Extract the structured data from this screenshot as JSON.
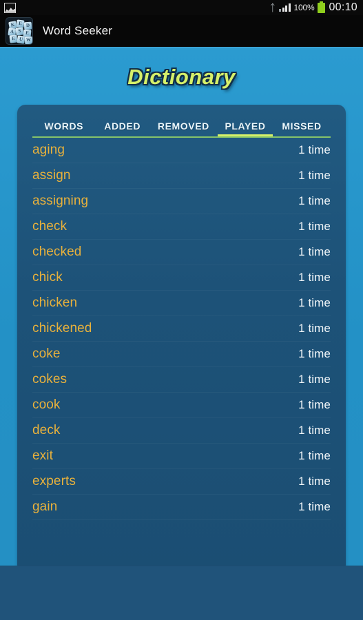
{
  "status_bar": {
    "notification_icon": "image-screenshot-icon",
    "bluetooth_icon": "bluetooth-icon",
    "signal_icon": "signal-bars-icon",
    "battery_percent": "100%",
    "battery_icon": "battery-full-icon",
    "clock": "00:10"
  },
  "action_bar": {
    "app_icon": "word-seeker-app-icon",
    "app_title": "Word Seeker",
    "icon_tiles": [
      "K",
      "E",
      "D",
      "A",
      "S",
      "E",
      "E",
      "U",
      "W"
    ]
  },
  "screen": {
    "title": "Dictionary"
  },
  "tabs": [
    {
      "label": "WORDS",
      "selected": false
    },
    {
      "label": "ADDED",
      "selected": false
    },
    {
      "label": "REMOVED",
      "selected": false
    },
    {
      "label": "PLAYED",
      "selected": true
    },
    {
      "label": "MISSED",
      "selected": false
    }
  ],
  "word_list": [
    {
      "word": "aging",
      "count": "1 time"
    },
    {
      "word": "assign",
      "count": "1 time"
    },
    {
      "word": "assigning",
      "count": "1 time"
    },
    {
      "word": "check",
      "count": "1 time"
    },
    {
      "word": "checked",
      "count": "1 time"
    },
    {
      "word": "chick",
      "count": "1 time"
    },
    {
      "word": "chicken",
      "count": "1 time"
    },
    {
      "word": "chickened",
      "count": "1 time"
    },
    {
      "word": "coke",
      "count": "1 time"
    },
    {
      "word": "cokes",
      "count": "1 time"
    },
    {
      "word": "cook",
      "count": "1 time"
    },
    {
      "word": "deck",
      "count": "1 time"
    },
    {
      "word": "exit",
      "count": "1 time"
    },
    {
      "word": "experts",
      "count": "1 time"
    },
    {
      "word": "gain",
      "count": "1 time"
    }
  ],
  "colors": {
    "page_background": "#2490c4",
    "card_background": "#1d5278",
    "title_text": "#d6f06a",
    "tab_indicator": "#d6f06a",
    "tab_rule": "#86c46a",
    "word_text": "#e8b13c",
    "count_text": "#f0f5f8",
    "bottom_band": "#20537a",
    "battery": "#8fce1d"
  }
}
